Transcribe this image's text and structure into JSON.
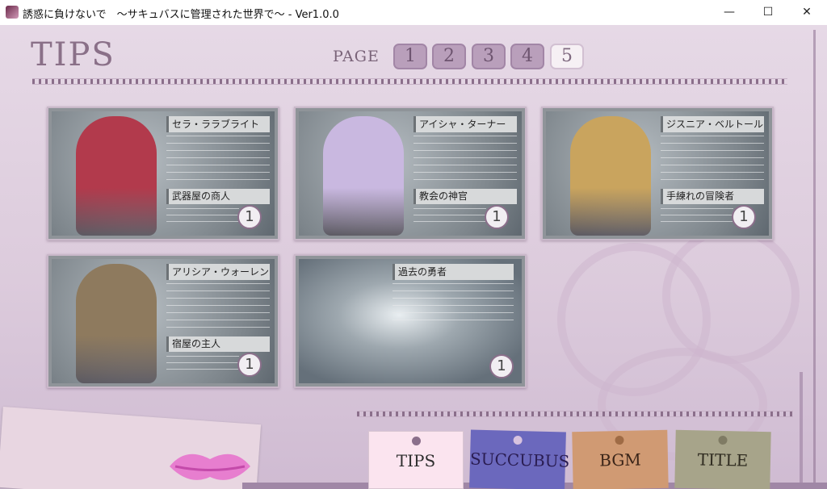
{
  "window": {
    "title": "誘惑に負けないで　～サキュバスに管理された世界で～ - Ver1.0.0",
    "minimize_glyph": "—",
    "maximize_glyph": "☐",
    "close_glyph": "✕"
  },
  "header": {
    "title": "TIPS",
    "page_label": "PAGE",
    "pages": [
      "1",
      "2",
      "3",
      "4",
      "5"
    ],
    "current_page": "5"
  },
  "cards": [
    {
      "name": "セラ・ララブライト",
      "role": "武器屋の商人",
      "count": "1",
      "portrait_color": "#b23a4c"
    },
    {
      "name": "アイシャ・ターナー",
      "role": "教会の神官",
      "count": "1",
      "portrait_color": "#c9b8e0"
    },
    {
      "name": "ジスニア・ベルトール",
      "role": "手練れの冒険者",
      "count": "1",
      "portrait_color": "#c9a45e"
    },
    {
      "name": "アリシア・ウォーレン",
      "role": "宿屋の主人",
      "count": "1",
      "portrait_color": "#8e7a5e"
    },
    {
      "name": "過去の勇者",
      "role": "",
      "count": "1",
      "portrait_color": ""
    }
  ],
  "tabs": {
    "tips": "TIPS",
    "succubus": "SUCCUBUS",
    "bgm": "BGM",
    "title": "TITLE"
  },
  "colors": {
    "background": "#dccbdc",
    "accent": "#8a7088",
    "tab_tips": "#fbe4ef",
    "tab_succubus": "#6b68bd",
    "tab_bgm": "#d09a73",
    "tab_title": "#a7a48a"
  }
}
